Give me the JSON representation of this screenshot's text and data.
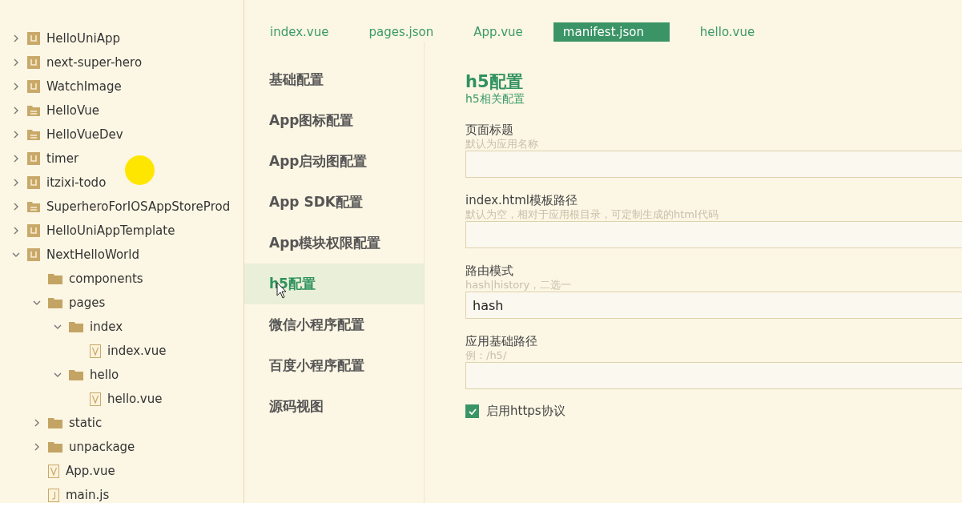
{
  "project_tree": [
    {
      "label": "HelloUniApp",
      "kind": "project",
      "expanded": false
    },
    {
      "label": "next-super-hero",
      "kind": "project",
      "expanded": false
    },
    {
      "label": "WatchImage",
      "kind": "project",
      "expanded": false
    },
    {
      "label": "HelloVue",
      "kind": "plain",
      "expanded": false
    },
    {
      "label": "HelloVueDev",
      "kind": "plain",
      "expanded": false
    },
    {
      "label": "timer",
      "kind": "project",
      "expanded": false
    },
    {
      "label": "itzixi-todo",
      "kind": "project",
      "expanded": false
    },
    {
      "label": "SuperheroForIOSAppStoreProd",
      "kind": "plain",
      "expanded": false
    },
    {
      "label": "HelloUniAppTemplate",
      "kind": "project",
      "expanded": false
    },
    {
      "label": "NextHelloWorld",
      "kind": "project",
      "expanded": true,
      "children": [
        {
          "label": "components",
          "kind": "folder"
        },
        {
          "label": "pages",
          "kind": "folder",
          "expanded": true,
          "children": [
            {
              "label": "index",
              "kind": "folder",
              "expanded": true,
              "children": [
                {
                  "label": "index.vue",
                  "kind": "vue"
                }
              ]
            },
            {
              "label": "hello",
              "kind": "folder",
              "expanded": true,
              "children": [
                {
                  "label": "hello.vue",
                  "kind": "vue"
                }
              ]
            }
          ]
        },
        {
          "label": "static",
          "kind": "folder",
          "expanded": false
        },
        {
          "label": "unpackage",
          "kind": "folder",
          "expanded": false
        },
        {
          "label": "App.vue",
          "kind": "vue"
        },
        {
          "label": "main.js",
          "kind": "js"
        }
      ]
    }
  ],
  "tabs": [
    {
      "label": "index.vue",
      "selected": false
    },
    {
      "label": "pages.json",
      "selected": false
    },
    {
      "label": "App.vue",
      "selected": false
    },
    {
      "label": "manifest.json",
      "selected": true
    },
    {
      "label": "hello.vue",
      "selected": false
    }
  ],
  "settings_nav": [
    {
      "label": "基础配置",
      "selected": false
    },
    {
      "label": "App图标配置",
      "selected": false
    },
    {
      "label": "App启动图配置",
      "selected": false
    },
    {
      "label": "App SDK配置",
      "selected": false
    },
    {
      "label": "App模块权限配置",
      "selected": false
    },
    {
      "label": "h5配置",
      "selected": true
    },
    {
      "label": "微信小程序配置",
      "selected": false
    },
    {
      "label": "百度小程序配置",
      "selected": false
    },
    {
      "label": "源码视图",
      "selected": false
    }
  ],
  "section": {
    "title": "h5配置",
    "subtitle": "h5相关配置"
  },
  "fields": [
    {
      "label": "页面标题",
      "hint": "默认为应用名称"
    },
    {
      "label": "index.html模板路径",
      "hint": "默认为空，相对于应用根目录，可定制生成的html代码"
    },
    {
      "label": "路由模式",
      "hint": "hash|history，二选一",
      "value": "hash"
    },
    {
      "label": "应用基础路径",
      "hint": "例：/h5/"
    }
  ],
  "https_option": {
    "label": "启用https协议",
    "checked": true
  }
}
